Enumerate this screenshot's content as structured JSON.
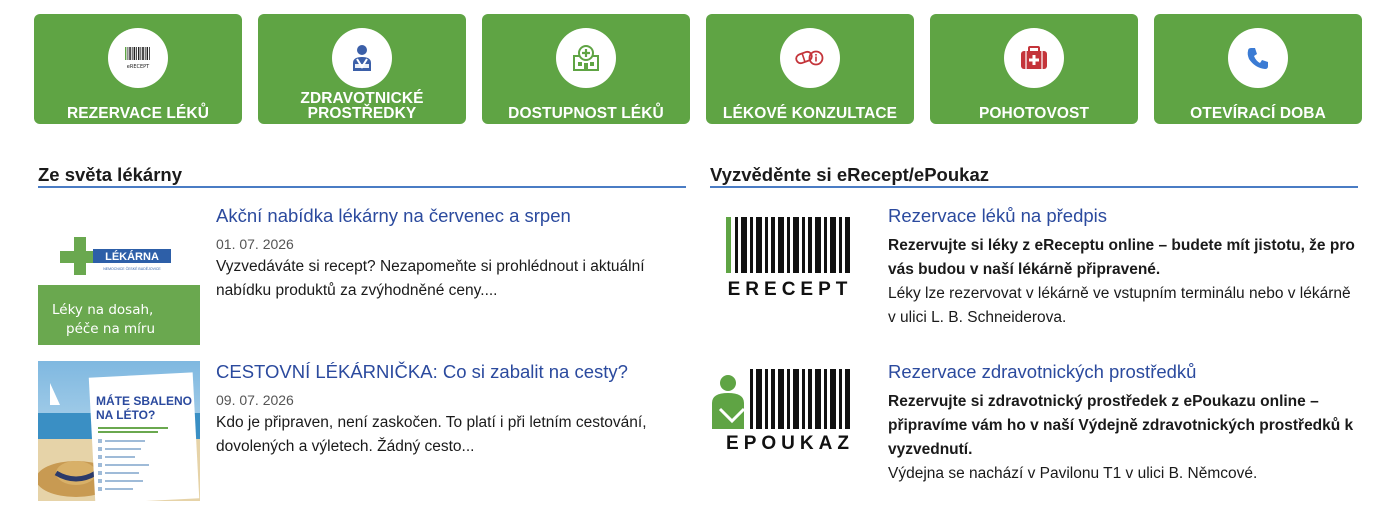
{
  "tiles": [
    {
      "label": "REZERVACE LÉKŮ",
      "icon": "barcode-erecept-icon"
    },
    {
      "label": "ZDRAVOTNICKÉ PROSTŘEDKY",
      "icon": "patient-icon"
    },
    {
      "label": "DOSTUPNOST LÉKŮ",
      "icon": "pharmacy-building-icon"
    },
    {
      "label": "LÉKOVÉ KONZULTACE",
      "icon": "pills-info-icon"
    },
    {
      "label": "POHOTOVOST",
      "icon": "first-aid-kit-icon"
    },
    {
      "label": "OTEVÍRACÍ DOBA",
      "icon": "phone-icon"
    }
  ],
  "tile_icon_text": "eRECEPT",
  "news": {
    "title": "Ze světa lékárny",
    "articles": [
      {
        "title": "Akční nabídka lékárny na červenec a srpen",
        "date": "01. 07. 2026",
        "text": "Vyzvedáváte si recept? Nezapomeňte si prohlédnout i aktuální nabídku produktů za zvýhodněné ceny....",
        "thumb": {
          "brand": "LÉKÁRNA",
          "brand_sub": "NEMOCNICE ČESKÉ BUDĚJOVICE",
          "slogan_1": "Léky na dosah,",
          "slogan_2": "péče na míru"
        }
      },
      {
        "title": "CESTOVNÍ LÉKÁRNIČKA: Co si zabalit na cesty?",
        "date": "09. 07. 2026",
        "text": "Kdo je připraven, není zaskočen. To platí i při letním cestování, dovolených a výletech. Žádný cesto...",
        "thumb": {
          "heading_1": "MÁTE SBALENO",
          "heading_2": "NA LÉTO?"
        }
      }
    ]
  },
  "erecept": {
    "title": "Vyzvěděnte si eRecept/ePoukaz",
    "items": [
      {
        "title": "Rezervace léků na předpis",
        "bold": "Rezervujte si léky z eReceptu online – budete mít jistotu, že pro vás budou v naší lékárně připravené.",
        "text": "Léky lze rezervovat v lékárně ve vstupním terminálu nebo v lékárně v ulici L. B. Schneiderova.",
        "logo_text": "ERECEPT"
      },
      {
        "title": "Rezervace zdravotnických prostředků",
        "bold": "Rezervujte si zdravotnický prostředek z ePoukazu online – připravíme vám ho v naší Výdejně zdravotnických prostředků k vyzvednutí.",
        "text": "Výdejna se nachází v Pavilonu T1 v ulici B. Němcové.",
        "logo_text": "EPOUKAZ"
      }
    ]
  },
  "colors": {
    "tile_green": "#5fa444",
    "link_blue": "#2b4a9e",
    "rule_blue": "#4a7cc4",
    "icon_red": "#c4343a",
    "icon_blue": "#3b7bd4"
  }
}
